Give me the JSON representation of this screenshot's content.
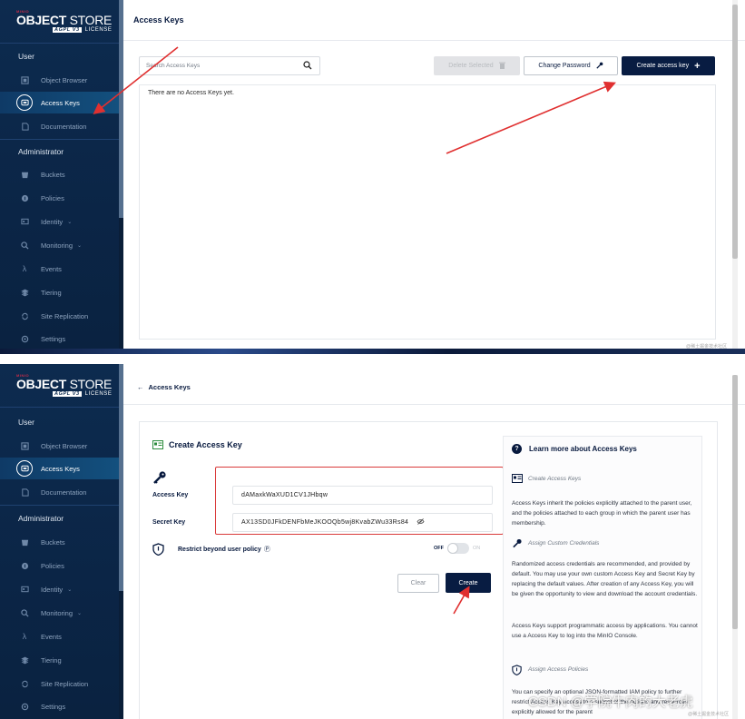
{
  "brand": {
    "mini": "MINIO",
    "name_bold": "OBJECT",
    "name_light": " STORE",
    "license_badge": "AGPL V3",
    "license": "LICENSE"
  },
  "sidebar": {
    "section_user": "User",
    "section_admin": "Administrator",
    "items": [
      {
        "label": "Object Browser",
        "icon": "object-browser-icon"
      },
      {
        "label": "Access Keys",
        "icon": "key-icon"
      },
      {
        "label": "Documentation",
        "icon": "document-icon"
      },
      {
        "label": "Buckets",
        "icon": "bucket-icon"
      },
      {
        "label": "Policies",
        "icon": "policy-icon"
      },
      {
        "label": "Identity",
        "icon": "identity-icon"
      },
      {
        "label": "Monitoring",
        "icon": "monitoring-icon"
      },
      {
        "label": "Events",
        "icon": "lambda-icon"
      },
      {
        "label": "Tiering",
        "icon": "tiering-icon"
      },
      {
        "label": "Site Replication",
        "icon": "replication-icon"
      },
      {
        "label": "Settings",
        "icon": "settings-icon"
      }
    ]
  },
  "top_panel": {
    "title": "Access Keys",
    "search_placeholder": "Search Access Keys",
    "delete_button": "Delete Selected",
    "change_password_button": "Change Password",
    "create_button": "Create access key",
    "empty_message": "There are no Access Keys yet."
  },
  "bottom_panel": {
    "back_link": "Access Keys",
    "form_title": "Create Access Key",
    "access_key_label": "Access Key",
    "access_key_value": "dAMaxkWaXUD1CV1JHbqw",
    "secret_key_label": "Secret Key",
    "secret_key_value": "AX13SD0JFkDENFbMeJKOOQb5wj8KvabZWu33Rs84",
    "restrict_label": "Restrict beyond user policy",
    "restrict_help": "Ⓟ",
    "toggle_off": "OFF",
    "toggle_on": "ON",
    "clear_button": "Clear",
    "create_button": "Create",
    "help": {
      "title": "Learn more about Access Keys",
      "sub1": "Create Access Keys",
      "text1": "Access Keys inherit the policies explicitly attached to the parent user, and the policies attached to each group in which the parent user has membership.",
      "sub2": "Assign Custom Credentials",
      "text2": "Randomized access credentials are recommended, and provided by default. You may use your own custom Access Key and Secret Key by replacing the default values. After creation of any Access Key, you will be given the opportunity to view and download the account credentials.",
      "text3": "Access Keys support programmatic access by applications. You cannot use a Access Key to log into the MinIO Console.",
      "sub3": "Assign Access Policies",
      "text4": "You can specify an optional JSON-formatted IAM policy to further restrict Access Key access to a subset of the actions and resources explicitly allowed for the parent"
    }
  },
  "watermark": {
    "main": "CSDN @学院牛肉的大老虎",
    "top_small": "@稀土掘金技术社区",
    "bottom_small": "@稀土掘金技术社区"
  },
  "colors": {
    "sidebar_bg": "#0d2b4f",
    "primary": "#081c42",
    "annotation_red": "#d93a3a"
  }
}
